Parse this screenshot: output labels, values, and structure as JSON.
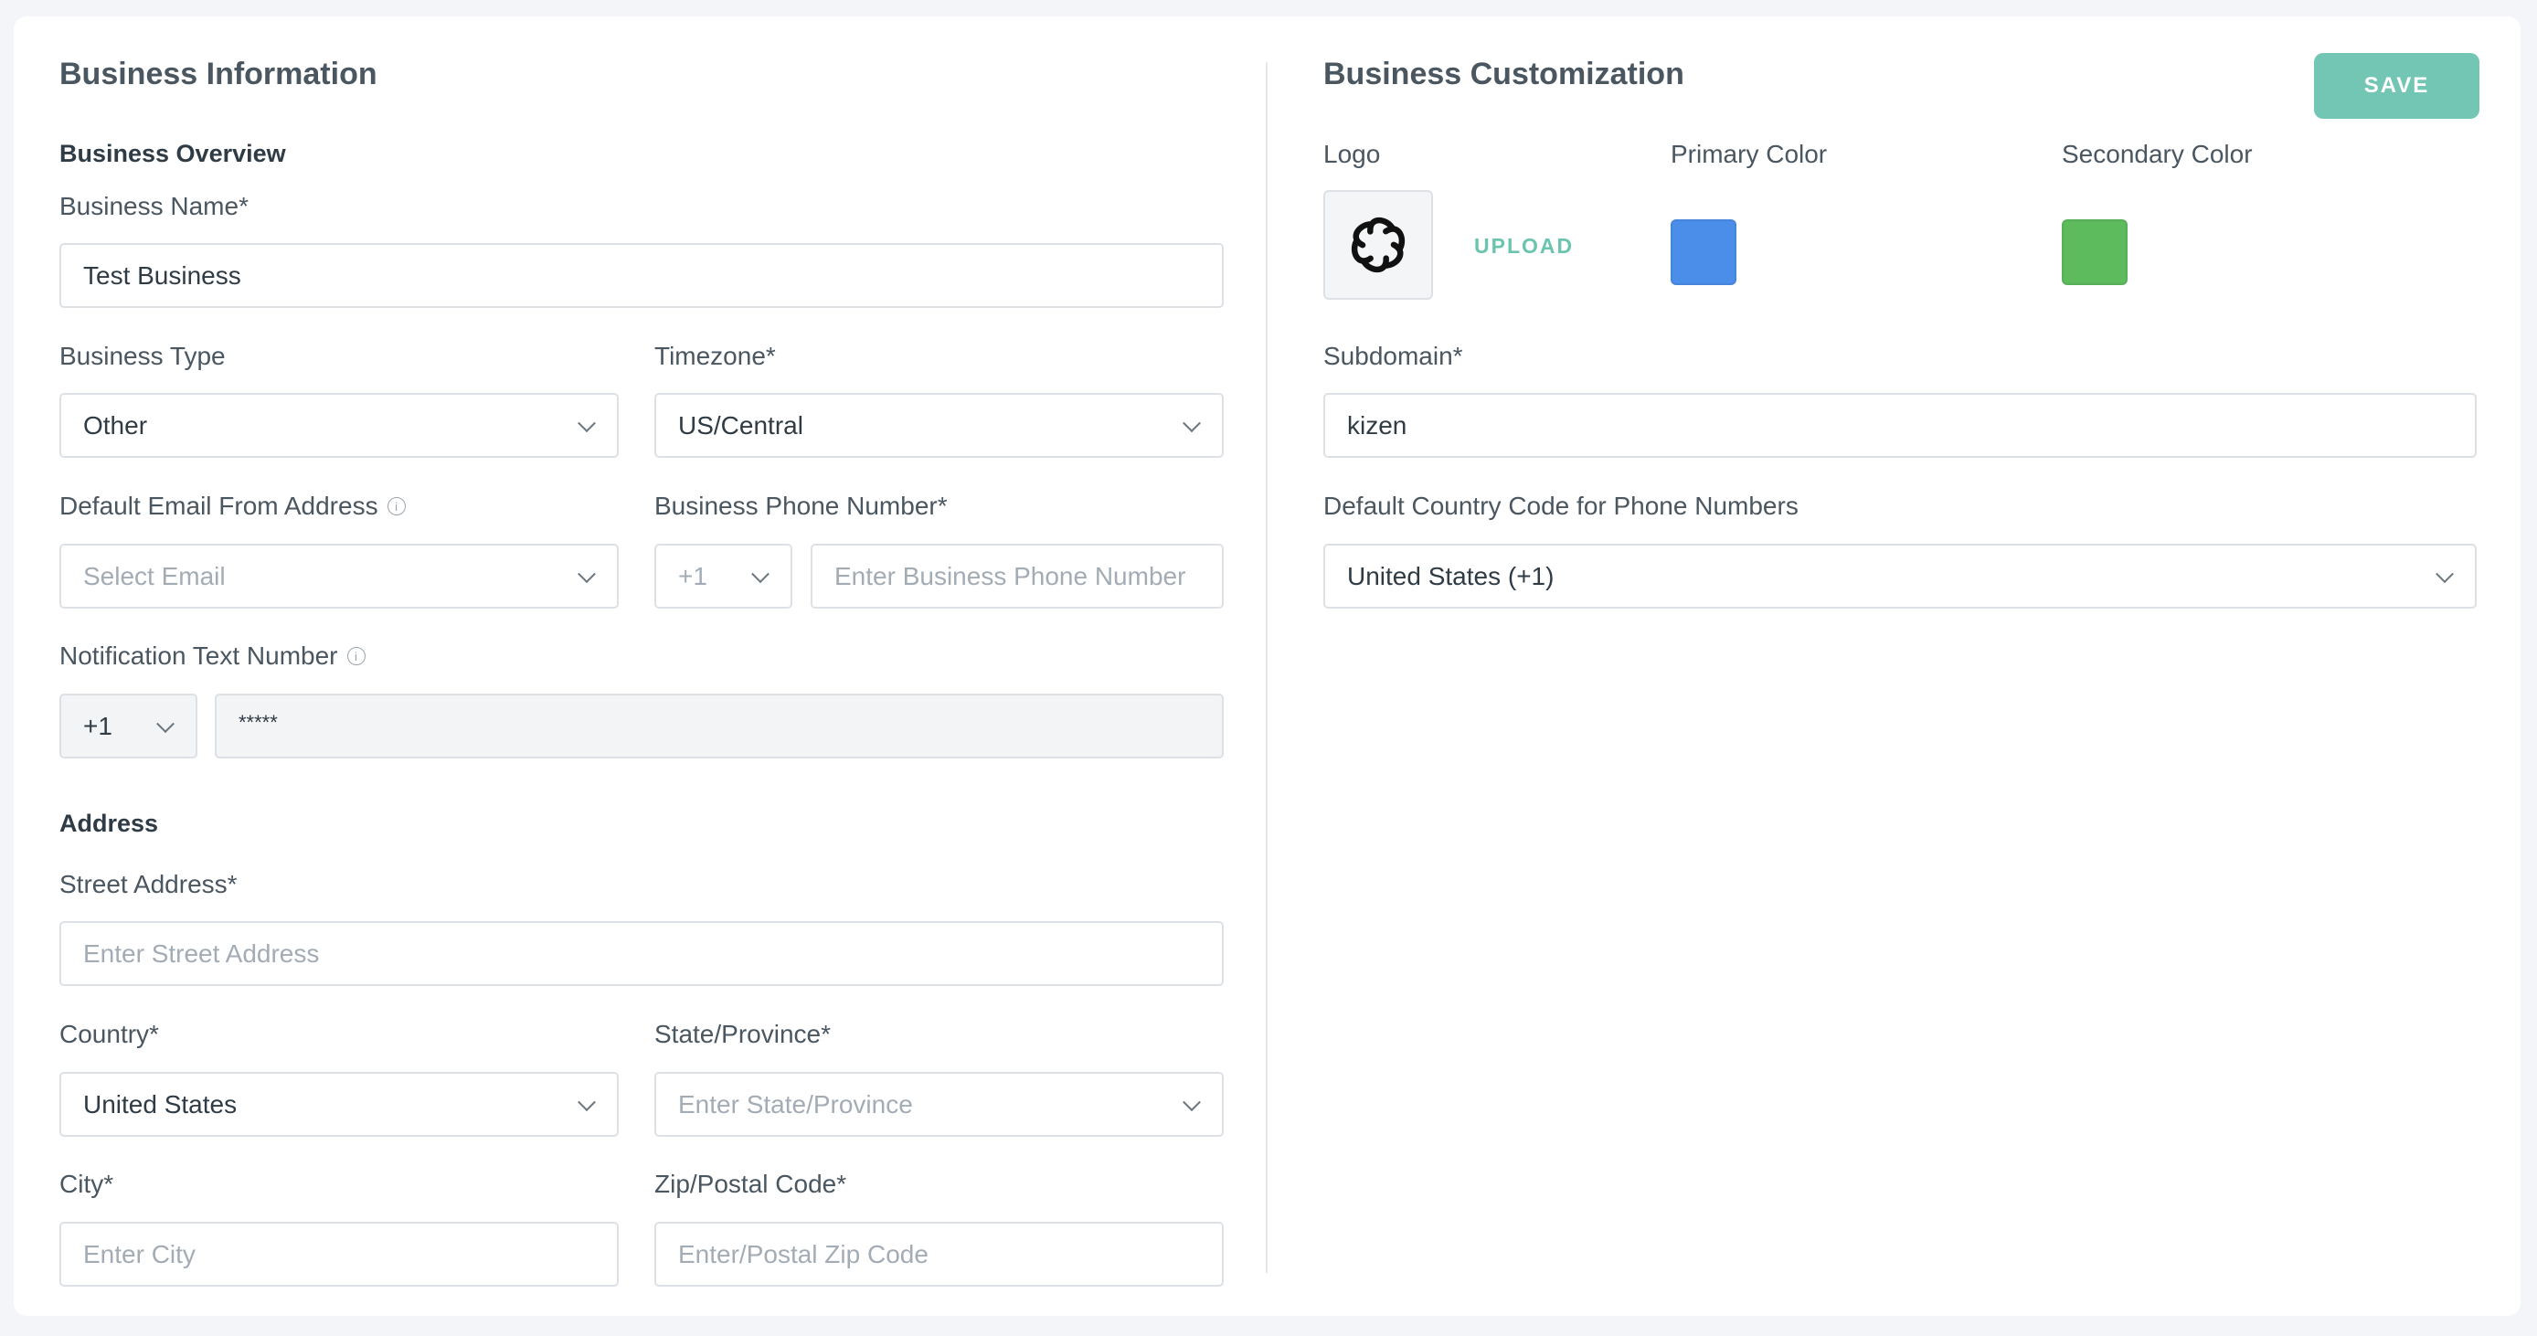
{
  "colors": {
    "accent": "#74c6b4",
    "primary_swatch": "#4b8ee9",
    "secondary_swatch": "#5dbb5e"
  },
  "left": {
    "title": "Business Information",
    "overview_heading": "Business Overview",
    "business_name": {
      "label": "Business Name*",
      "value": "Test Business"
    },
    "business_type": {
      "label": "Business Type",
      "value": "Other"
    },
    "timezone": {
      "label": "Timezone*",
      "value": "US/Central"
    },
    "default_email": {
      "label": "Default Email From Address",
      "placeholder": "Select Email",
      "info_icon": "info-icon"
    },
    "business_phone": {
      "label": "Business Phone Number*",
      "country_code": "+1",
      "placeholder": "Enter Business Phone Number"
    },
    "notification_text": {
      "label": "Notification Text Number",
      "country_code": "+1",
      "value": "*****",
      "info_icon": "info-icon"
    },
    "address_heading": "Address",
    "street": {
      "label": "Street Address*",
      "placeholder": "Enter Street Address"
    },
    "country": {
      "label": "Country*",
      "value": "United States"
    },
    "state": {
      "label": "State/Province*",
      "placeholder": "Enter State/Province"
    },
    "city": {
      "label": "City*",
      "placeholder": "Enter City"
    },
    "zip": {
      "label": "Zip/Postal Code*",
      "placeholder": "Enter/Postal Zip Code"
    }
  },
  "right": {
    "title": "Business Customization",
    "save_label": "SAVE",
    "logo_label": "Logo",
    "upload_label": "UPLOAD",
    "primary_color_label": "Primary Color",
    "secondary_color_label": "Secondary Color",
    "subdomain": {
      "label": "Subdomain*",
      "value": "kizen"
    },
    "country_code": {
      "label": "Default Country Code for Phone Numbers",
      "value": "United States (+1)"
    }
  }
}
